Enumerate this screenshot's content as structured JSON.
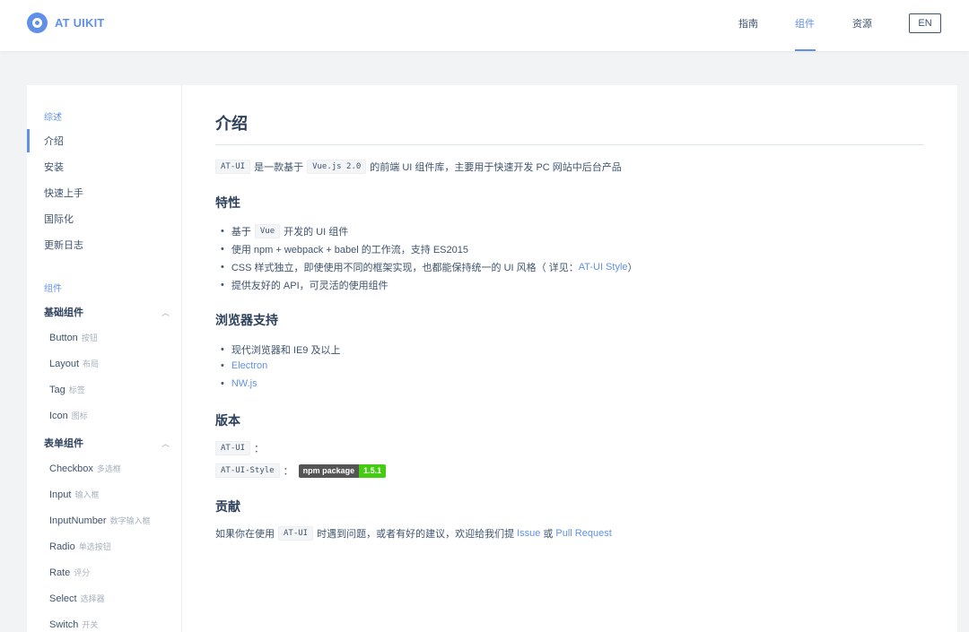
{
  "header": {
    "logo_text": "AT UIKIT",
    "nav": [
      "指南",
      "组件",
      "资源"
    ],
    "active_nav": "组件",
    "lang": "EN"
  },
  "sidebar": {
    "overview_title": "综述",
    "overview_items": [
      "介绍",
      "安装",
      "快速上手",
      "国际化",
      "更新日志"
    ],
    "components_title": "组件",
    "sections": [
      {
        "title": "基础组件",
        "items": [
          {
            "en": "Button",
            "cn": "按钮"
          },
          {
            "en": "Layout",
            "cn": "布局"
          },
          {
            "en": "Tag",
            "cn": "标签"
          },
          {
            "en": "Icon",
            "cn": "图标"
          }
        ]
      },
      {
        "title": "表单组件",
        "items": [
          {
            "en": "Checkbox",
            "cn": "多选框"
          },
          {
            "en": "Input",
            "cn": "输入框"
          },
          {
            "en": "InputNumber",
            "cn": "数字输入框"
          },
          {
            "en": "Radio",
            "cn": "单选按钮"
          },
          {
            "en": "Rate",
            "cn": "评分"
          },
          {
            "en": "Select",
            "cn": "选择器"
          },
          {
            "en": "Switch",
            "cn": "开关"
          }
        ]
      }
    ]
  },
  "content": {
    "title": "介绍",
    "intro": {
      "code1": "AT-UI",
      "text1": "是一款基于",
      "code2": "Vue.js 2.0",
      "text2": "的前端 UI 组件库，主要用于快速开发 PC 网站中后台产品"
    },
    "features_title": "特性",
    "features": {
      "f1_pre": "基于",
      "f1_code": "Vue",
      "f1_post": "开发的 UI 组件",
      "f2": "使用 npm + webpack + babel 的工作流，支持 ES2015",
      "f3_pre": "CSS 样式独立，即使使用不同的框架实现，也都能保持统一的 UI 风格（ 详见：",
      "f3_link": "AT-UI Style",
      "f3_post": "）",
      "f4": "提供友好的 API，可灵活的使用组件"
    },
    "browser_title": "浏览器支持",
    "browser": {
      "b1": "现代浏览器和 IE9 及以上",
      "b2": "Electron",
      "b3": "NW.js"
    },
    "version_title": "版本",
    "version": {
      "v1_code": "AT-UI",
      "v1_colon": "：",
      "v2_code": "AT-UI-Style",
      "v2_colon": "：",
      "badge_label": "npm package",
      "badge_value": "1.5.1"
    },
    "contrib_title": "贡献",
    "contrib": {
      "pre": "如果你在使用",
      "code": "AT-UI",
      "mid": "时遇到问题，或者有好的建议，欢迎给我们提",
      "link1": "Issue",
      "or": "或",
      "link2": "Pull Request"
    }
  },
  "colors": {
    "accent": "#6190e8",
    "text": "#3f536e",
    "heading": "#2c405a",
    "badge_green": "#44cc11"
  }
}
